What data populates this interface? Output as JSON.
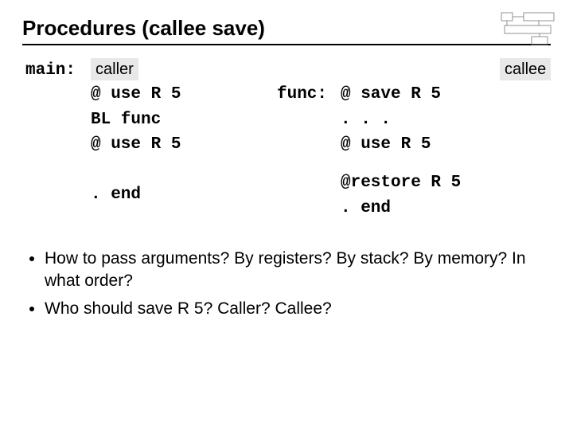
{
  "title": "Procedures (callee save)",
  "labels": {
    "main": "main:",
    "func": "func:",
    "caller": "caller",
    "callee": "callee"
  },
  "caller_code": {
    "l1": "@ use R 5",
    "l2": "BL func",
    "l3": "@ use R 5",
    "end": ". end"
  },
  "callee_code": {
    "l1": "@ save R 5",
    "l2": ". . .",
    "l3": "@ use R 5",
    "l4": "@restore R 5",
    "end": ". end"
  },
  "bullets": {
    "b1": "How to pass arguments? By registers? By stack? By memory? In what order?",
    "b2": "Who should save R 5? Caller? Callee?"
  }
}
